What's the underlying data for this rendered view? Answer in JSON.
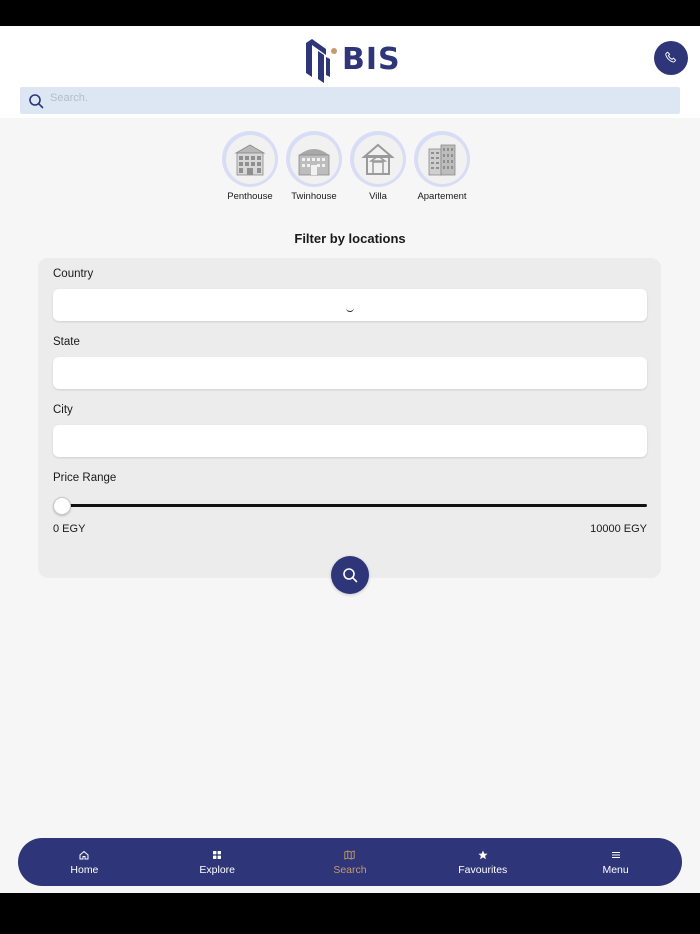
{
  "header": {
    "logo_text": "BIS"
  },
  "search": {
    "placeholder": "Search."
  },
  "categories": [
    {
      "label": "Penthouse",
      "icon": "penthouse-building-icon"
    },
    {
      "label": "Twinhouse",
      "icon": "twinhouse-building-icon"
    },
    {
      "label": "Villa",
      "icon": "villa-house-icon"
    },
    {
      "label": "Apartement",
      "icon": "apartment-building-icon"
    }
  ],
  "filter": {
    "title": "Filter by locations",
    "country_label": "Country",
    "state_label": "State",
    "city_label": "City",
    "price_label": "Price Range",
    "price_min": "0 EGY",
    "price_max": "10000 EGY",
    "price_slider_value": 0
  },
  "nav": [
    {
      "label": "Home",
      "icon": "home-icon",
      "active": false
    },
    {
      "label": "Explore",
      "icon": "grid-icon",
      "active": false
    },
    {
      "label": "Search",
      "icon": "map-icon",
      "active": true
    },
    {
      "label": "Favourites",
      "icon": "star-icon",
      "active": false
    },
    {
      "label": "Menu",
      "icon": "menu-icon",
      "active": false
    }
  ],
  "colors": {
    "primary": "#2e3578",
    "active_nav": "#c79a6a",
    "search_bg": "#dde7f3",
    "category_ring": "#d9dcf5"
  }
}
